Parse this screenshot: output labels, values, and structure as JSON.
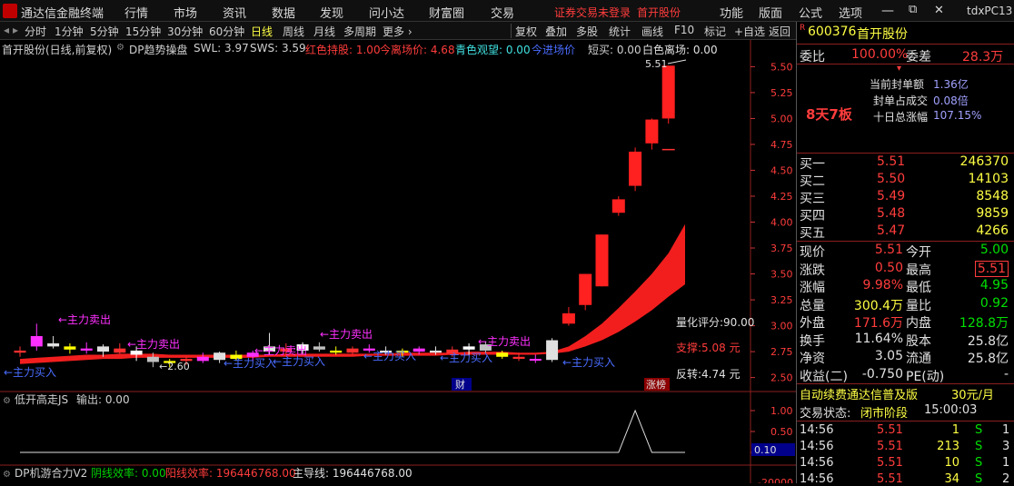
{
  "menu": {
    "app_title": "通达信金融终端",
    "items": [
      "行情",
      "市场",
      "资讯",
      "数据",
      "发现",
      "问小达",
      "财富圈",
      "交易"
    ],
    "notice": "证券交易未登录",
    "stock_shortcut": "首开股份",
    "right_items": [
      "功能",
      "版面",
      "公式",
      "选项"
    ],
    "user": "tdxPC13"
  },
  "toolbar": {
    "periods": [
      "分时",
      "1分钟",
      "5分钟",
      "15分钟",
      "30分钟",
      "60分钟",
      "日线",
      "周线",
      "月线",
      "多周期",
      "更多 ›"
    ],
    "active": "日线",
    "actions": [
      "复权",
      "叠加",
      "多股",
      "统计",
      "画线",
      "F10",
      "标记",
      "+自选",
      "返回"
    ]
  },
  "main_indicator": {
    "name": "首开股份(日线,前复权)",
    "formula": "DP趋势操盘",
    "swl_label": "SWL: 3.97",
    "sws_label": "SWS: 3.59",
    "red_hold": "红色持股: 1.00",
    "today_leave": "今离场价: 4.68",
    "cyan_watch": "青色观望: 0.00",
    "today_enter": "今进场价",
    "short_sell": "短买: 0.00",
    "white_leave": "白色离场: 0.00"
  },
  "price_axis": [
    "5.50",
    "5.25",
    "5.00",
    "4.75",
    "4.50",
    "4.25",
    "4.00",
    "3.75",
    "3.50",
    "3.25",
    "3.00",
    "2.75",
    "2.50"
  ],
  "chart_labels": {
    "high_tag": "5.51",
    "low_tag": "2.60",
    "score": "量化评分:90.00",
    "support": "支撑:5.08 元",
    "reversal": "反转:4.74 元",
    "cai_tag": "财",
    "limit_tag": "涨榜",
    "sell_tags": [
      "←主力卖出",
      "←主力卖出",
      "←主力卖出",
      "←主力卖出",
      "←主力卖出"
    ],
    "buy_tags": [
      "←主力买入",
      "←主力买入",
      "←主力买入",
      "←主力买入",
      "←主力买入",
      "←主力买入"
    ]
  },
  "sub1": {
    "title": "低开高走JS",
    "output": "输出: 0.00",
    "axis": [
      "1.00",
      "0.50",
      "0.00"
    ],
    "tag": "0.10"
  },
  "sub2": {
    "title": "DP机游合力V2",
    "yin": "阴线效率: 0.00",
    "yang": "阳线效率: 196446768.00",
    "main": "主导线: 196446768.00",
    "axis_tail": "-20000"
  },
  "quote": {
    "code": "600376",
    "name": "首开股份",
    "r_tag": "R",
    "wb_label": "委比",
    "wb_value": "100.00%",
    "wc_label": "委差",
    "wc_value": "28.3万",
    "seal_amt_label": "当前封单额",
    "seal_amt": "1.36亿",
    "seal_ratio_label": "封单占成交",
    "seal_ratio": "0.08倍",
    "ten_day_label": "十日总涨幅",
    "ten_day": "107.15%",
    "streak": "8天7板",
    "bids": [
      {
        "l": "买一",
        "p": "5.51",
        "v": "246370"
      },
      {
        "l": "买二",
        "p": "5.50",
        "v": "14103"
      },
      {
        "l": "买三",
        "p": "5.49",
        "v": "8548"
      },
      {
        "l": "买四",
        "p": "5.48",
        "v": "9859"
      },
      {
        "l": "买五",
        "p": "5.47",
        "v": "4266"
      }
    ],
    "stats": [
      {
        "l1": "现价",
        "v1": "5.51",
        "l2": "今开",
        "v2": "5.00"
      },
      {
        "l1": "涨跌",
        "v1": "0.50",
        "l2": "最高",
        "v2": "5.51"
      },
      {
        "l1": "涨幅",
        "v1": "9.98%",
        "l2": "最低",
        "v2": "4.95"
      },
      {
        "l1": "总量",
        "v1": "300.4万",
        "l2": "量比",
        "v2": "0.92"
      },
      {
        "l1": "外盘",
        "v1": "171.6万",
        "l2": "内盘",
        "v2": "128.8万"
      },
      {
        "l1": "换手",
        "v1": "11.64%",
        "l2": "股本",
        "v2": "25.8亿"
      },
      {
        "l1": "净资",
        "v1": "3.05",
        "l2": "流通",
        "v2": "25.8亿"
      },
      {
        "l1": "收益(二)",
        "v1": "-0.750",
        "l2": "PE(动)",
        "v2": "-"
      }
    ],
    "ad": "自动续费通达信普及版",
    "ad_price": "30元/月",
    "status_label": "交易状态:",
    "status_value": "闭市阶段",
    "status_time": "15:00:03",
    "ticks": [
      {
        "t": "14:56",
        "p": "5.51",
        "v": "1",
        "d": "S",
        "n": "1"
      },
      {
        "t": "14:56",
        "p": "5.51",
        "v": "213",
        "d": "S",
        "n": "3"
      },
      {
        "t": "14:56",
        "p": "5.51",
        "v": "10",
        "d": "S",
        "n": "1"
      },
      {
        "t": "14:56",
        "p": "5.51",
        "v": "34",
        "d": "S",
        "n": "2"
      }
    ]
  },
  "chart_data": {
    "type": "candlestick",
    "ylim": [
      2.4,
      5.6
    ],
    "candles": [
      {
        "o": 2.74,
        "h": 2.8,
        "l": 2.7,
        "c": 2.76
      },
      {
        "o": 2.8,
        "h": 3.02,
        "l": 2.76,
        "c": 2.9
      },
      {
        "o": 2.83,
        "h": 2.9,
        "l": 2.78,
        "c": 2.8
      },
      {
        "o": 2.77,
        "h": 2.83,
        "l": 2.73,
        "c": 2.8
      },
      {
        "o": 2.78,
        "h": 2.84,
        "l": 2.73,
        "c": 2.76
      },
      {
        "o": 2.75,
        "h": 2.82,
        "l": 2.7,
        "c": 2.8
      },
      {
        "o": 2.78,
        "h": 2.83,
        "l": 2.73,
        "c": 2.74
      },
      {
        "o": 2.72,
        "h": 2.8,
        "l": 2.66,
        "c": 2.76
      },
      {
        "o": 2.7,
        "h": 2.74,
        "l": 2.6,
        "c": 2.65
      },
      {
        "o": 2.64,
        "h": 2.68,
        "l": 2.6,
        "c": 2.66
      },
      {
        "o": 2.66,
        "h": 2.7,
        "l": 2.62,
        "c": 2.68
      },
      {
        "o": 2.7,
        "h": 2.74,
        "l": 2.64,
        "c": 2.66
      },
      {
        "o": 2.67,
        "h": 2.75,
        "l": 2.64,
        "c": 2.74
      },
      {
        "o": 2.72,
        "h": 2.76,
        "l": 2.66,
        "c": 2.68
      },
      {
        "o": 2.7,
        "h": 2.76,
        "l": 2.66,
        "c": 2.74
      },
      {
        "o": 2.75,
        "h": 2.93,
        "l": 2.72,
        "c": 2.8
      },
      {
        "o": 2.78,
        "h": 2.83,
        "l": 2.72,
        "c": 2.75
      },
      {
        "o": 2.76,
        "h": 2.84,
        "l": 2.73,
        "c": 2.82
      },
      {
        "o": 2.8,
        "h": 2.84,
        "l": 2.75,
        "c": 2.77
      },
      {
        "o": 2.76,
        "h": 2.8,
        "l": 2.72,
        "c": 2.74
      },
      {
        "o": 2.74,
        "h": 2.8,
        "l": 2.72,
        "c": 2.78
      },
      {
        "o": 2.78,
        "h": 2.82,
        "l": 2.74,
        "c": 2.76
      },
      {
        "o": 2.76,
        "h": 2.8,
        "l": 2.72,
        "c": 2.74
      },
      {
        "o": 2.74,
        "h": 2.78,
        "l": 2.7,
        "c": 2.76
      },
      {
        "o": 2.75,
        "h": 2.8,
        "l": 2.72,
        "c": 2.78
      },
      {
        "o": 2.76,
        "h": 2.8,
        "l": 2.72,
        "c": 2.74
      },
      {
        "o": 2.73,
        "h": 2.8,
        "l": 2.7,
        "c": 2.77
      },
      {
        "o": 2.77,
        "h": 2.83,
        "l": 2.72,
        "c": 2.8
      },
      {
        "o": 2.82,
        "h": 2.85,
        "l": 2.74,
        "c": 2.76
      },
      {
        "o": 2.74,
        "h": 2.76,
        "l": 2.68,
        "c": 2.7
      },
      {
        "o": 2.7,
        "h": 2.74,
        "l": 2.66,
        "c": 2.68
      },
      {
        "o": 2.68,
        "h": 2.72,
        "l": 2.64,
        "c": 2.67
      },
      {
        "o": 2.67,
        "h": 2.88,
        "l": 2.65,
        "c": 2.86
      },
      {
        "o": 3.02,
        "h": 3.18,
        "l": 3.0,
        "c": 3.12
      },
      {
        "o": 3.2,
        "h": 3.5,
        "l": 3.15,
        "c": 3.5
      },
      {
        "o": 3.38,
        "h": 3.88,
        "l": 3.38,
        "c": 3.88
      },
      {
        "o": 4.09,
        "h": 4.25,
        "l": 4.06,
        "c": 4.22
      },
      {
        "o": 4.35,
        "h": 4.72,
        "l": 4.3,
        "c": 4.68
      },
      {
        "o": 4.76,
        "h": 5.0,
        "l": 4.7,
        "c": 4.99
      },
      {
        "o": 5.0,
        "h": 5.51,
        "l": 4.95,
        "c": 5.51
      },
      {
        "o": 4.7,
        "h": 4.7,
        "l": 4.7,
        "c": 4.7
      }
    ],
    "band": {
      "upper": [
        2.68,
        2.69,
        2.7,
        2.71,
        2.72,
        2.72,
        2.73,
        2.73,
        2.73,
        2.72,
        2.72,
        2.72,
        2.72,
        2.72,
        2.72,
        2.72,
        2.73,
        2.73,
        2.73,
        2.73,
        2.73,
        2.73,
        2.73,
        2.74,
        2.74,
        2.74,
        2.74,
        2.75,
        2.75,
        2.75,
        2.74,
        2.74,
        2.75,
        2.8,
        2.9,
        3.02,
        3.17,
        3.33,
        3.5,
        3.7,
        3.98
      ],
      "lower": [
        2.63,
        2.64,
        2.65,
        2.66,
        2.67,
        2.68,
        2.68,
        2.69,
        2.69,
        2.69,
        2.69,
        2.69,
        2.69,
        2.69,
        2.69,
        2.7,
        2.7,
        2.7,
        2.7,
        2.7,
        2.7,
        2.71,
        2.71,
        2.71,
        2.71,
        2.71,
        2.72,
        2.72,
        2.72,
        2.72,
        2.72,
        2.72,
        2.73,
        2.75,
        2.8,
        2.86,
        2.94,
        3.04,
        3.15,
        3.28,
        3.4
      ]
    },
    "sub1_values": [
      0,
      0,
      0,
      0,
      0,
      0,
      0,
      0,
      0,
      0,
      0,
      0,
      0,
      0,
      0,
      0,
      0,
      0,
      0,
      0,
      0,
      0,
      0,
      0,
      0,
      0,
      0,
      0,
      0,
      0,
      0,
      0,
      0,
      0,
      0,
      0,
      0,
      1,
      0,
      0,
      0
    ]
  }
}
